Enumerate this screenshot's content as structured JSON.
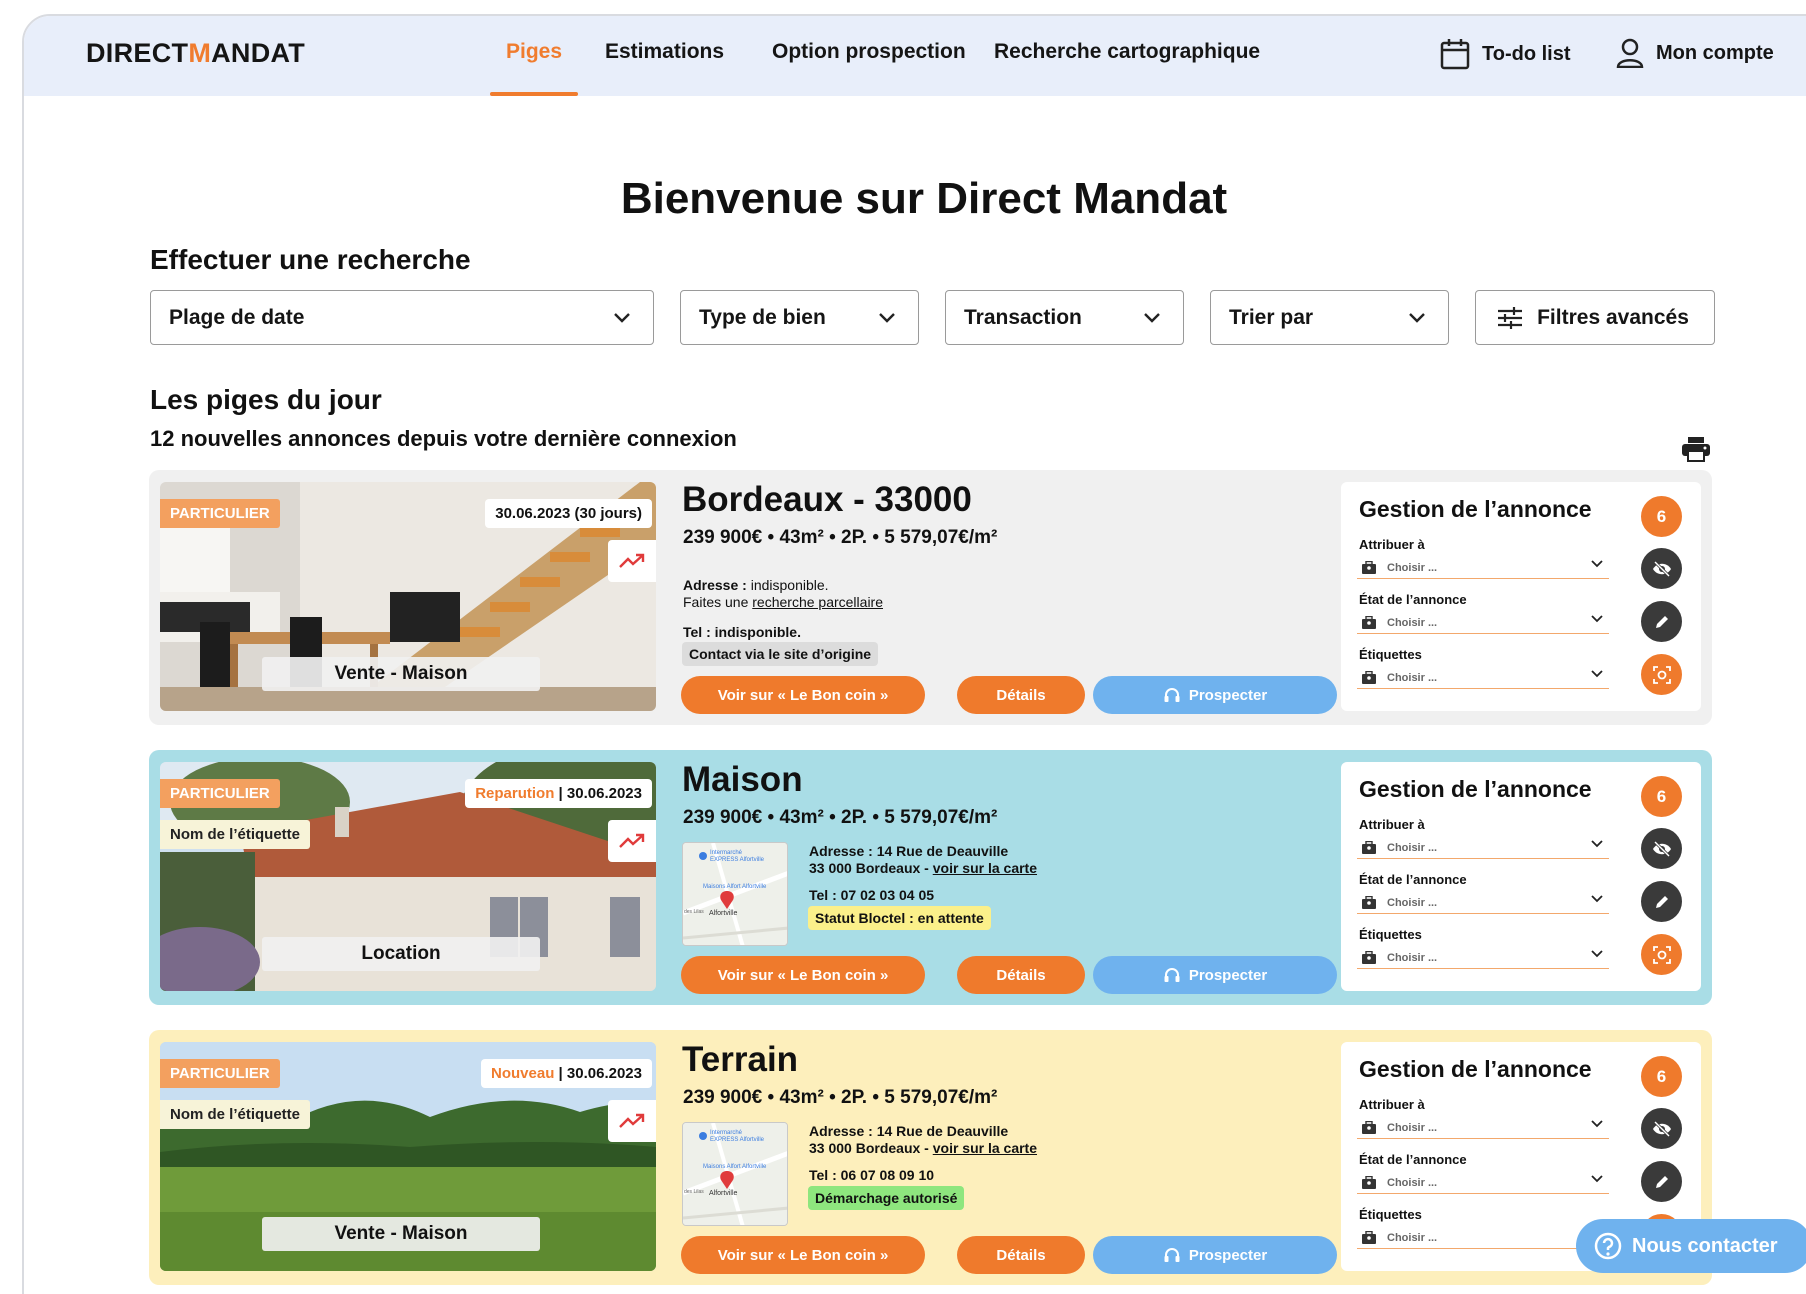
{
  "header": {
    "logo_prefix": "DIRECT",
    "logo_m": "M",
    "logo_suffix": "ANDAT",
    "nav": [
      "Piges",
      "Estimations",
      "Option prospection",
      "Recherche cartographique"
    ],
    "todo_label": "To-do list",
    "account_label": "Mon compte"
  },
  "page_title": "Bienvenue sur Direct Mandat",
  "search": {
    "heading": "Effectuer une recherche",
    "filters": [
      "Plage de date",
      "Type de bien",
      "Transaction",
      "Trier par"
    ],
    "advanced": "Filtres avancés"
  },
  "daily": {
    "heading": "Les piges du jour",
    "subheading": "12 nouvelles annonces depuis votre dernière connexion"
  },
  "colors": {
    "accent": "#f07c2e",
    "blue": "#6fb2ee",
    "card1": "#f0f0f0",
    "card2": "#a9dde6",
    "card3": "#fdefbc"
  },
  "listings": [
    {
      "badge": "PARTICULIER",
      "label_tag": "",
      "status_prefix": "",
      "date": "30.06.2023 (30 jours)",
      "property_type": "Vente - Maison",
      "title": "Bordeaux - 33000",
      "price_line": "239 900€ • 43m² • 2P. • 5 579,07€/m²",
      "address_label": "Adresse :",
      "address_value": " indisponible.",
      "address_line2_prefix": "Faites une ",
      "address_link": "recherche parcellaire",
      "tel": "Tel : indisponible.",
      "chip": "Contact via le site d’origine",
      "btn_view": "Voir sur « Le Bon coin »",
      "btn_details": "Détails",
      "btn_prospect": "Prospecter"
    },
    {
      "badge": "PARTICULIER",
      "label_tag": "Nom de l’étiquette",
      "status_prefix": "Reparution",
      "date": "30.06.2023",
      "property_type": "Location",
      "title": "Maison",
      "price_line": "239 900€ • 43m² • 2P. • 5 579,07€/m²",
      "address_label": "Adresse : 14 Rue de Deauville",
      "address_line2_prefix": "33 000 Bordeaux - ",
      "address_link": "voir sur la carte",
      "tel": "Tel : 07 02 03 04 05",
      "chip": "Statut Bloctel : en attente",
      "map_labels": [
        "Intermarché",
        "EXPRESS Alfortville",
        "Maisons Alfort Alfortville",
        "des Lilas",
        "Alfortville"
      ],
      "btn_view": "Voir sur « Le Bon coin »",
      "btn_details": "Détails",
      "btn_prospect": "Prospecter"
    },
    {
      "badge": "PARTICULIER",
      "label_tag": "Nom de l’étiquette",
      "status_prefix": "Nouveau",
      "date": "30.06.2023",
      "property_type": "Vente - Maison",
      "title": "Terrain",
      "price_line": "239 900€ • 43m² • 2P. • 5 579,07€/m²",
      "address_label": "Adresse : 14 Rue de Deauville",
      "address_line2_prefix": "33 000 Bordeaux - ",
      "address_link": "voir sur la carte",
      "tel": "Tel : 06 07 08 09 10",
      "chip": "Démarchage autorisé",
      "map_labels": [
        "Intermarché",
        "EXPRESS Alfortville",
        "Maisons Alfort Alfortville",
        "des Lilas",
        "Alfortville"
      ],
      "btn_view": "Voir sur « Le Bon coin »",
      "btn_details": "Détails",
      "btn_prospect": "Prospecter"
    }
  ],
  "panel": {
    "title": "Gestion de l’annonce",
    "count": "6",
    "fields": [
      "Attribuer à",
      "État de l’annonce",
      "Étiquettes"
    ],
    "placeholder": "Choisir ..."
  },
  "contact_button": "Nous contacter"
}
